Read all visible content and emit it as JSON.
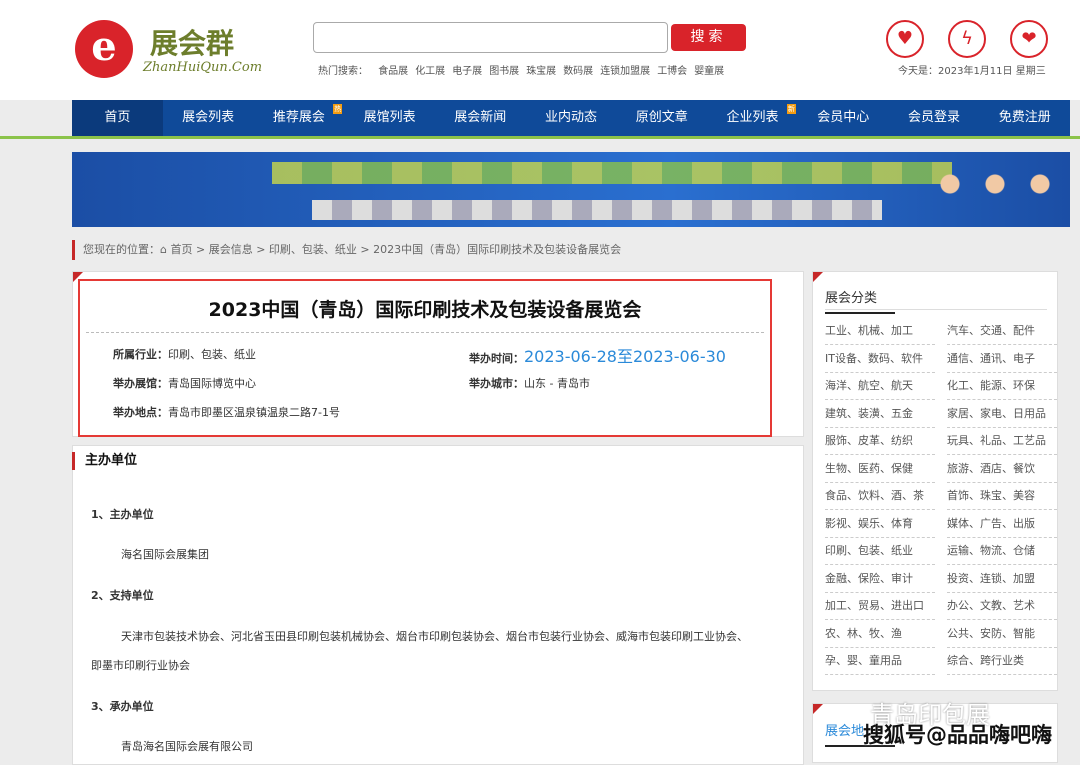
{
  "header": {
    "logo_cn": "展会群",
    "logo_en": "ZhanHuiQun.Com",
    "search_placeholder": "",
    "search_button": "搜索",
    "hot_label": "热门搜索：",
    "hot": [
      "食品展",
      "化工展",
      "电子展",
      "图书展",
      "珠宝展",
      "数码展",
      "连锁加盟展",
      "工博会",
      "婴童展"
    ],
    "date": "今天是：2023年1月11日 星期三",
    "icons": [
      "shield-icon",
      "lightning-icon",
      "heart-hand-icon"
    ]
  },
  "nav": [
    {
      "label": "首页"
    },
    {
      "label": "展会列表"
    },
    {
      "label": "推荐展会",
      "badge": "热"
    },
    {
      "label": "展馆列表"
    },
    {
      "label": "展会新闻"
    },
    {
      "label": "业内动态"
    },
    {
      "label": "原创文章"
    },
    {
      "label": "企业列表",
      "badge": "新"
    },
    {
      "label": "会员中心"
    },
    {
      "label": "会员登录"
    },
    {
      "label": "免费注册"
    }
  ],
  "breadcrumb": {
    "label": "您现在的位置：",
    "items": [
      "首页",
      "展会信息",
      "印刷、包装、纸业",
      "2023中国（青岛）国际印刷技术及包装设备展览会"
    ]
  },
  "expo": {
    "title": "2023中国（青岛）国际印刷技术及包装设备展览会",
    "industry_label": "所属行业：",
    "industry": "印刷、包装、纸业",
    "time_label": "举办时间：",
    "time": "2023-06-28至2023-06-30",
    "venue_label": "举办展馆：",
    "venue": "青岛国际博览中心",
    "city_label": "举办城市：",
    "city": "山东 - 青岛市",
    "address_label": "举办地点：",
    "address": "青岛市即墨区温泉镇温泉二路7-1号"
  },
  "organizers": {
    "heading": "主办单位",
    "s1": "1、主办单位",
    "s1_text": "海名国际会展集团",
    "s2": "2、支持单位",
    "s2_text_1": "天津市包装技术协会、河北省玉田县印刷包装机械协会、烟台市印刷包装协会、烟台市包装行业协会、威海市包装印刷工业协会、",
    "s2_text_2": "即墨市印刷行业协会",
    "s3": "3、承办单位",
    "s3_text": "青岛海名国际会展有限公司"
  },
  "sidebar": {
    "title": "展会分类",
    "categories": [
      "工业、机械、加工",
      "汽车、交通、配件",
      "IT设备、数码、软件",
      "通信、通讯、电子",
      "海洋、航空、航天",
      "化工、能源、环保",
      "建筑、装潢、五金",
      "家居、家电、日用品",
      "服饰、皮革、纺织",
      "玩具、礼品、工艺品",
      "生物、医药、保健",
      "旅游、酒店、餐饮",
      "食品、饮料、酒、茶",
      "首饰、珠宝、美容",
      "影视、娱乐、体育",
      "媒体、广告、出版",
      "印刷、包装、纸业",
      "运输、物流、仓储",
      "金融、保险、审计",
      "投资、连锁、加盟",
      "加工、贸易、进出口",
      "办公、文教、艺术",
      "农、林、牧、渔",
      "公共、安防、智能",
      "孕、婴、童用品",
      "综合、跨行业类"
    ],
    "second_title": "展会地"
  },
  "watermark": {
    "line1": "青岛印包展",
    "line2": "搜狐号@品品嗨吧嗨"
  }
}
